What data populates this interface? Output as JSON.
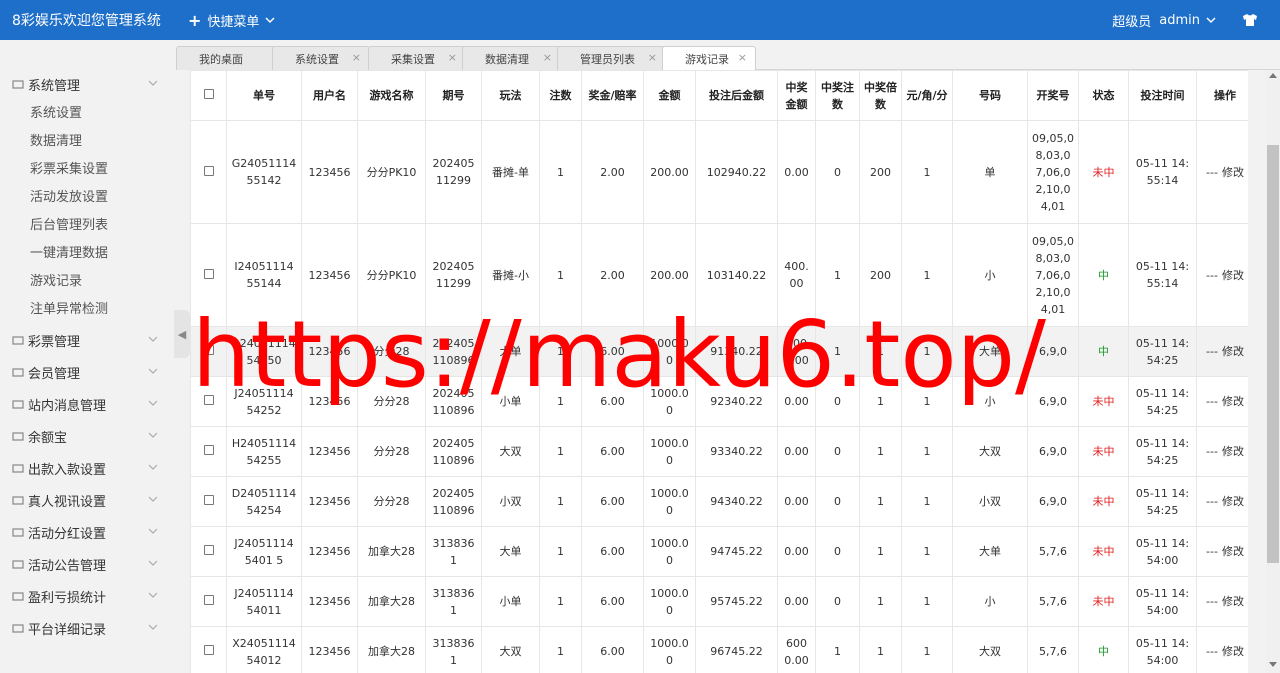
{
  "header": {
    "title": "8彩娱乐欢迎您管理系统",
    "quick_menu": "快捷菜单",
    "role": "超级员",
    "user": "admin"
  },
  "sidebar": {
    "groups": [
      {
        "label": "系统管理",
        "items": [
          "系统设置",
          "数据清理",
          "彩票采集设置",
          "活动发放设置",
          "后台管理列表",
          "一键清理数据",
          "游戏记录",
          "注单异常检测"
        ]
      },
      {
        "label": "彩票管理"
      },
      {
        "label": "会员管理"
      },
      {
        "label": "站内消息管理"
      },
      {
        "label": "余额宝"
      },
      {
        "label": "出款入款设置"
      },
      {
        "label": "真人视讯设置"
      },
      {
        "label": "活动分红设置"
      },
      {
        "label": "活动公告管理"
      },
      {
        "label": "盈利亏损统计"
      },
      {
        "label": "平台详细记录"
      }
    ]
  },
  "tabs": [
    {
      "label": "我的桌面"
    },
    {
      "label": "系统设置"
    },
    {
      "label": "采集设置"
    },
    {
      "label": "数据清理"
    },
    {
      "label": "管理员列表"
    },
    {
      "label": "游戏记录",
      "active": true
    }
  ],
  "table": {
    "columns": [
      "单号",
      "用户名",
      "游戏名称",
      "期号",
      "玩法",
      "注数",
      "奖金/赔率",
      "金额",
      "投注后金额",
      "中奖金额",
      "中奖注数",
      "中奖倍数",
      "元/角/分",
      "号码",
      "开奖号",
      "状态",
      "投注时间",
      "操作"
    ],
    "action_prefix": "---",
    "action_label": "修改",
    "rows": [
      {
        "id": "G2405111455142",
        "user": "123456",
        "game": "分分PK10",
        "period": "20240511299",
        "play": "番摊-单",
        "count": "1",
        "odds": "2.00",
        "amount": "200.00",
        "after": "102940.22",
        "win": "0.00",
        "win_count": "0",
        "win_mult": "200",
        "unit": "1",
        "number": "单",
        "draw": "09,05,08,03,07,06,02,10,04,01",
        "status": "未中",
        "status_type": "lose",
        "time": "05-11 14:55:14"
      },
      {
        "id": "I2405111455144",
        "user": "123456",
        "game": "分分PK10",
        "period": "20240511299",
        "play": "番摊-小",
        "count": "1",
        "odds": "2.00",
        "amount": "200.00",
        "after": "103140.22",
        "win": "400.00",
        "win_count": "1",
        "win_mult": "200",
        "unit": "1",
        "number": "小",
        "draw": "09,05,08,03,07,06,02,10,04,01",
        "status": "中",
        "status_type": "win",
        "time": "05-11 14:55:14"
      },
      {
        "id": "A2405111454250",
        "user": "123456",
        "game": "分分28",
        "period": "202405110896",
        "play": "大单",
        "count": "1",
        "odds": "6.00",
        "amount": "1000.00",
        "after": "91340.22",
        "win": "6000.00",
        "win_count": "1",
        "win_mult": "1",
        "unit": "1",
        "number": "大单",
        "draw": "6,9,0",
        "status": "中",
        "status_type": "win",
        "time": "05-11 14:54:25"
      },
      {
        "id": "J2405111454252",
        "user": "123456",
        "game": "分分28",
        "period": "202405110896",
        "play": "小单",
        "count": "1",
        "odds": "6.00",
        "amount": "1000.00",
        "after": "92340.22",
        "win": "0.00",
        "win_count": "0",
        "win_mult": "1",
        "unit": "1",
        "number": "小",
        "draw": "6,9,0",
        "status": "未中",
        "status_type": "lose",
        "time": "05-11 14:54:25"
      },
      {
        "id": "H2405111454255",
        "user": "123456",
        "game": "分分28",
        "period": "202405110896",
        "play": "大双",
        "count": "1",
        "odds": "6.00",
        "amount": "1000.00",
        "after": "93340.22",
        "win": "0.00",
        "win_count": "0",
        "win_mult": "1",
        "unit": "1",
        "number": "大双",
        "draw": "6,9,0",
        "status": "未中",
        "status_type": "lose",
        "time": "05-11 14:54:25"
      },
      {
        "id": "D2405111454254",
        "user": "123456",
        "game": "分分28",
        "period": "202405110896",
        "play": "小双",
        "count": "1",
        "odds": "6.00",
        "amount": "1000.00",
        "after": "94340.22",
        "win": "0.00",
        "win_count": "0",
        "win_mult": "1",
        "unit": "1",
        "number": "小双",
        "draw": "6,9,0",
        "status": "未中",
        "status_type": "lose",
        "time": "05-11 14:54:25"
      },
      {
        "id": "J240511145401 5",
        "user": "123456",
        "game": "加拿大28",
        "period": "3138361",
        "play": "大单",
        "count": "1",
        "odds": "6.00",
        "amount": "1000.00",
        "after": "94745.22",
        "win": "0.00",
        "win_count": "0",
        "win_mult": "1",
        "unit": "1",
        "number": "大单",
        "draw": "5,7,6",
        "status": "未中",
        "status_type": "lose",
        "time": "05-11 14:54:00"
      },
      {
        "id": "J2405111454011",
        "user": "123456",
        "game": "加拿大28",
        "period": "3138361",
        "play": "小单",
        "count": "1",
        "odds": "6.00",
        "amount": "1000.00",
        "after": "95745.22",
        "win": "0.00",
        "win_count": "0",
        "win_mult": "1",
        "unit": "1",
        "number": "小",
        "draw": "5,7,6",
        "status": "未中",
        "status_type": "lose",
        "time": "05-11 14:54:00"
      },
      {
        "id": "X2405111454012",
        "user": "123456",
        "game": "加拿大28",
        "period": "3138361",
        "play": "大双",
        "count": "1",
        "odds": "6.00",
        "amount": "1000.00",
        "after": "96745.22",
        "win": "6000.00",
        "win_count": "1",
        "win_mult": "1",
        "unit": "1",
        "number": "大双",
        "draw": "5,7,6",
        "status": "中",
        "status_type": "win",
        "time": "05-11 14:54:00"
      }
    ]
  },
  "watermark": "https://maku6.top/",
  "colors": {
    "header_bg": "#1E6FC9",
    "status_lose": "#e02020",
    "status_win": "#1a9a2a",
    "watermark": "#ff0000"
  }
}
